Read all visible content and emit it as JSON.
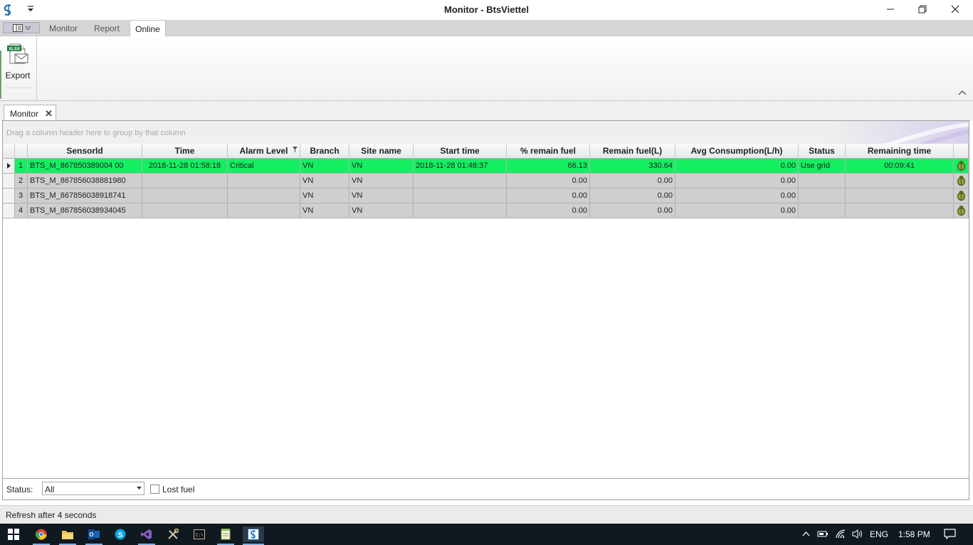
{
  "window": {
    "title": "Monitor - BtsViettel"
  },
  "ribbon": {
    "tabs": [
      {
        "label": "Monitor",
        "active": false
      },
      {
        "label": "Report",
        "active": false
      },
      {
        "label": "Online",
        "active": true
      }
    ],
    "export_label": "Export",
    "export_icon_text": "XLSX"
  },
  "document_tab": {
    "label": "Monitor"
  },
  "grid": {
    "group_hint": "Drag a column header here to group by that column",
    "columns": [
      "SensorId",
      "Time",
      "Alarm Level",
      "Branch",
      "Site name",
      "Start time",
      "% remain fuel",
      "Remain fuel(L)",
      "Avg Consumption(L/h)",
      "Status",
      "Remaining time"
    ],
    "rows": [
      {
        "no": "1",
        "sensor_id": "BTS_M_867850389004 00",
        "time": "2018-11-28 01:58:18",
        "alarm": "Critical",
        "branch": "VN",
        "site": "VN",
        "start": "2018-11-28 01:48:37",
        "remain_pct": "66.13",
        "remain_l": "330.64",
        "avg": "0.00",
        "status": "Use grid",
        "remaining_time": "00:09:41",
        "highlight": "green"
      },
      {
        "no": "2",
        "sensor_id": "BTS_M_867856038881980",
        "time": "",
        "alarm": "",
        "branch": "VN",
        "site": "VN",
        "start": "",
        "remain_pct": "0.00",
        "remain_l": "0.00",
        "avg": "0.00",
        "status": "",
        "remaining_time": "",
        "highlight": "gray"
      },
      {
        "no": "3",
        "sensor_id": "BTS_M_867856038918741",
        "time": "",
        "alarm": "",
        "branch": "VN",
        "site": "VN",
        "start": "",
        "remain_pct": "0.00",
        "remain_l": "0.00",
        "avg": "0.00",
        "status": "",
        "remaining_time": "",
        "highlight": "gray"
      },
      {
        "no": "4",
        "sensor_id": "BTS_M_867856038934045",
        "time": "",
        "alarm": "",
        "branch": "VN",
        "site": "VN",
        "start": "",
        "remain_pct": "0.00",
        "remain_l": "0.00",
        "avg": "0.00",
        "status": "",
        "remaining_time": "",
        "highlight": "gray"
      }
    ]
  },
  "filter": {
    "status_label": "Status:",
    "status_value": "All",
    "lost_fuel_label": "Lost fuel"
  },
  "statusbar": {
    "text": "Refresh after 4 seconds"
  },
  "taskbar": {
    "language": "ENG",
    "time": "1:58 PM"
  },
  "colors": {
    "highlight_green": "#16ee62",
    "row_gray": "#cfcfcf"
  }
}
